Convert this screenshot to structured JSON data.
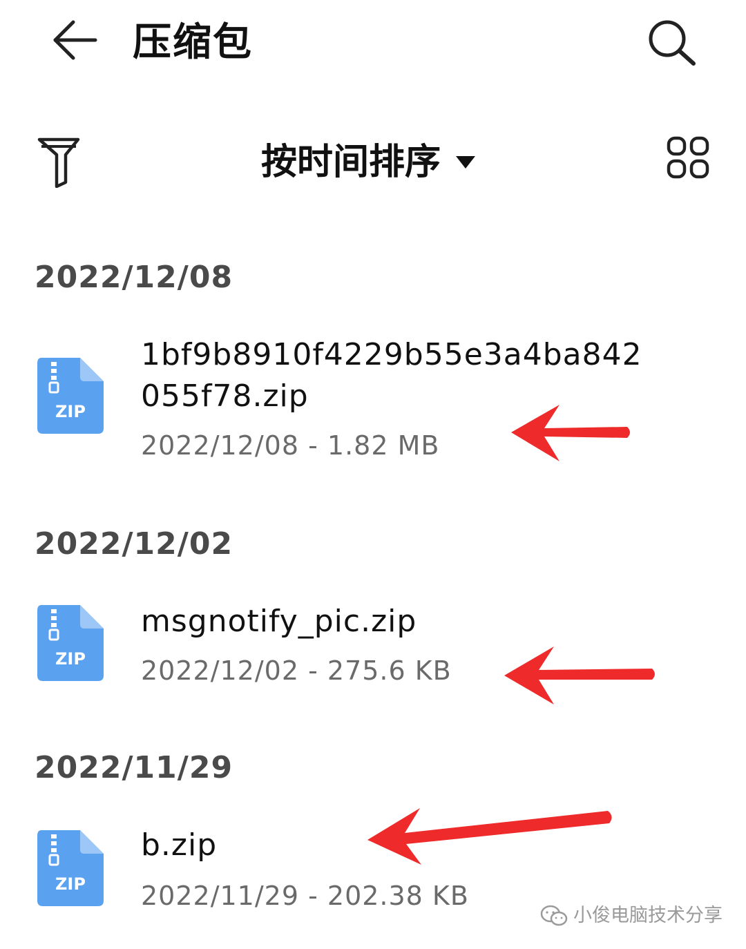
{
  "header": {
    "title": "压缩包",
    "back_icon": "arrow-left-icon",
    "search_icon": "search-icon"
  },
  "toolbar": {
    "filter_icon": "filter-icon",
    "sort_label": "按时间排序",
    "sort_caret_icon": "caret-down-icon",
    "view_icon": "grid-view-icon"
  },
  "groups": [
    {
      "date": "2022/12/08",
      "files": [
        {
          "name": "1bf9b8910f4229b55e3a4ba842\n055f78.zip",
          "meta": "2022/12/08 - 1.82 MB",
          "icon_label": "ZIP"
        }
      ]
    },
    {
      "date": "2022/12/02",
      "files": [
        {
          "name": "msgnotify_pic.zip",
          "meta": "2022/12/02 - 275.6 KB",
          "icon_label": "ZIP"
        }
      ]
    },
    {
      "date": "2022/11/29",
      "files": [
        {
          "name": "b.zip",
          "meta": "2022/11/29 - 202.38 KB",
          "icon_label": "ZIP"
        }
      ]
    }
  ],
  "watermark": {
    "text": "小俊电脑技术分享"
  },
  "colors": {
    "zip_icon": "#5aa2f0",
    "zip_icon_fold": "#9cc7f6",
    "annotation_arrow": "#ee2a2a",
    "date_header": "#4a4a4a",
    "meta_text": "#6a6a6a"
  }
}
